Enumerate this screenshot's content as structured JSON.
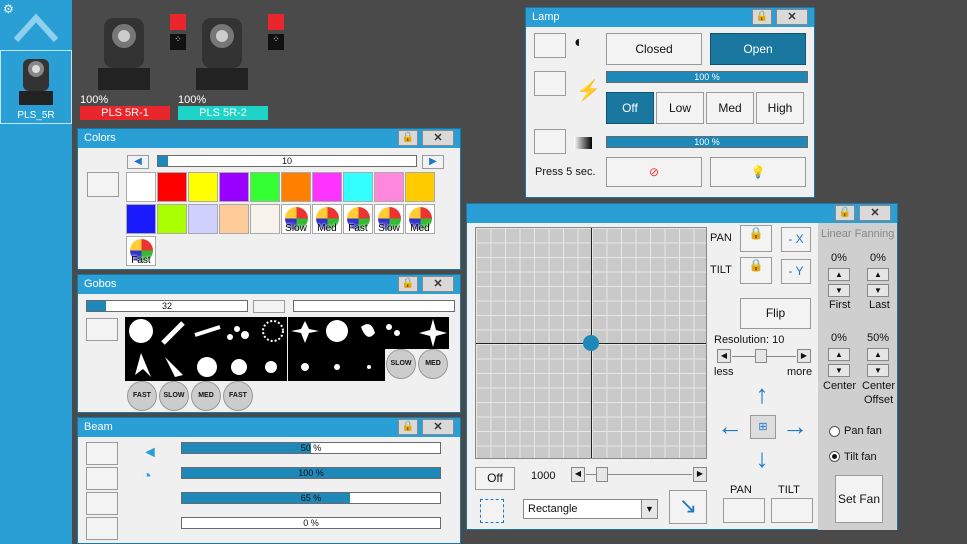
{
  "sidebar": {
    "fixture_label": "PLS_5R",
    "gear": "gear-icon",
    "up": "chevron-up-icon"
  },
  "fixtures": [
    {
      "pct": "100%",
      "name": "PLS 5R-1",
      "color": "#e8262c"
    },
    {
      "pct": "100%",
      "name": "PLS 5R-2",
      "color": "#1ed3c8"
    }
  ],
  "lamp": {
    "title": "Lamp",
    "closed": "Closed",
    "open": "Open",
    "dimmer": "100 %",
    "off": "Off",
    "low": "Low",
    "med": "Med",
    "high": "High",
    "shutter": "100 %",
    "press": "Press 5 sec."
  },
  "colors": {
    "title": "Colors",
    "value": "10",
    "swatches1": [
      "#ffffff",
      "#ff0000",
      "#ffff00",
      "#9900ff",
      "#33ff33",
      "#ff8000",
      "#ff33ff",
      "#33ffff",
      "#ff88dd",
      "#ffcc00"
    ],
    "swatches2": [
      "#1a1aff",
      "#aaff00",
      "#d0d0ff",
      "#ffcc99",
      "#f7f2ec"
    ],
    "wheels": [
      "Slow",
      "Med",
      "Fast",
      "Slow",
      "Med"
    ],
    "extra": "Fast"
  },
  "gobos": {
    "title": "Gobos",
    "value": "32",
    "rot": [
      "FAST",
      "SLOW",
      "MED",
      "FAST"
    ],
    "rot2": [
      "SLOW",
      "MED"
    ]
  },
  "beam": {
    "title": "Beam",
    "bars": [
      {
        "label": "50 %",
        "v": 0.5
      },
      {
        "label": "100 %",
        "v": 1.0
      },
      {
        "label": "65 %",
        "v": 0.65
      },
      {
        "label": "0 %",
        "v": 0.0
      }
    ]
  },
  "pantilt": {
    "pan": "PAN",
    "tilt": "TILT",
    "negx": "- X",
    "negy": "- Y",
    "flip": "Flip",
    "resolution": "Resolution: 10",
    "less": "less",
    "more": "more",
    "off": "Off",
    "speed": "1000",
    "shape": "Rectangle",
    "pan2": "PAN",
    "tilt2": "TILT"
  },
  "fan": {
    "title": "Linear Fanning",
    "first_pct": "0%",
    "last_pct": "0%",
    "first": "First",
    "last": "Last",
    "center_pct": "0%",
    "offset_pct": "50%",
    "center": "Center",
    "offset1": "Center",
    "offset2": "Offset",
    "panfan": "Pan fan",
    "tiltfan": "Tilt fan",
    "set": "Set Fan"
  }
}
